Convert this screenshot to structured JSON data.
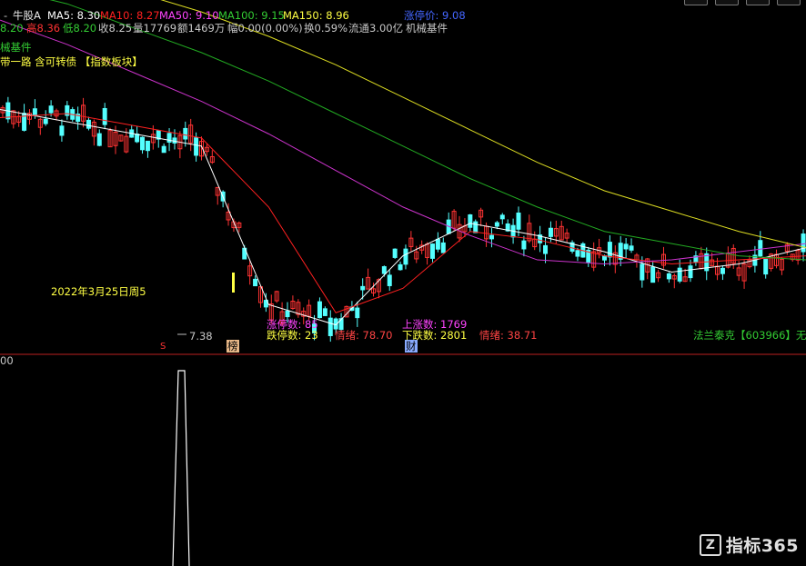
{
  "header": {
    "stock_name": "牛股A",
    "ma5": "MA5: 8.30",
    "ma10": "MA10: 8.27",
    "ma50": "MA50: 9.10",
    "ma100": "MA100: 9.15",
    "ma150": "MA150: 8.96",
    "limit_up": "涨停价: 9.08",
    "low_prefix": "8.20",
    "high": "高8.36",
    "low": "低8.20",
    "close": "收8.25",
    "volume": "量17769",
    "amount": "额1469万",
    "change": "幅0.00(0.00%)",
    "turnover": "换0.59%",
    "float_cap": "流通3.00亿",
    "industry": "机械基件",
    "industry_short": "械基件",
    "concepts": "带一路 含可转债 【指数板块】"
  },
  "annotations": {
    "date_label": "2022年3月25日周5",
    "min_price": "7.38",
    "marker_s": "S",
    "marker_bang": "榜",
    "marker_cai": "财",
    "limit_up_count": "涨停数: 85",
    "limit_down_count": "跌停数: 23",
    "sentiment_1": "情绪: 78.70",
    "up_count": "上涨数: 1769",
    "down_count": "下跌数: 2801",
    "sentiment_2": "情绪: 38.71",
    "stock_tag": "法兰泰克【603966】无"
  },
  "sub_panel": {
    "axis_label": "00"
  },
  "watermark": {
    "logo_letter": "Z",
    "text": "指标365"
  },
  "colors": {
    "up": "#ff3333",
    "down": "#54ffff",
    "ma5": "#ffffff",
    "ma10": "#ff2020",
    "ma50": "#cc33cc",
    "ma100": "#22aa22",
    "ma150": "#dddd22",
    "text_gray": "#c8c8c8",
    "label_yellow": "#ffff44",
    "label_magenta": "#ff44ff",
    "label_red": "#ff4444",
    "label_blue": "#4466ff",
    "label_green": "#33cc33"
  },
  "chart_data": {
    "type": "line",
    "x": [
      0,
      10,
      20,
      30,
      40,
      50,
      60,
      70,
      80,
      90,
      100,
      110,
      120
    ],
    "ylim": [
      7.2,
      11.0
    ],
    "series": [
      {
        "name": "MA5",
        "values": [
          10.1,
          9.95,
          9.8,
          9.65,
          7.7,
          7.45,
          8.3,
          8.7,
          8.55,
          8.35,
          8.1,
          8.2,
          8.4
        ]
      },
      {
        "name": "MA10",
        "values": [
          10.0,
          10.05,
          9.9,
          9.75,
          8.9,
          7.6,
          7.9,
          8.6,
          8.5,
          8.3,
          8.2,
          8.25,
          8.3
        ]
      },
      {
        "name": "MA50",
        "values": [
          11.2,
          10.9,
          10.55,
          10.2,
          9.8,
          9.35,
          8.9,
          8.55,
          8.25,
          8.2,
          8.25,
          8.35,
          8.45
        ]
      },
      {
        "name": "MA100",
        "values": [
          11.6,
          11.4,
          11.1,
          10.8,
          10.45,
          10.05,
          9.65,
          9.25,
          8.9,
          8.6,
          8.45,
          8.3,
          8.25
        ]
      },
      {
        "name": "MA150",
        "values": [
          11.9,
          11.75,
          11.55,
          11.3,
          11.0,
          10.65,
          10.25,
          9.85,
          9.45,
          9.1,
          8.85,
          8.6,
          8.4
        ]
      }
    ]
  }
}
